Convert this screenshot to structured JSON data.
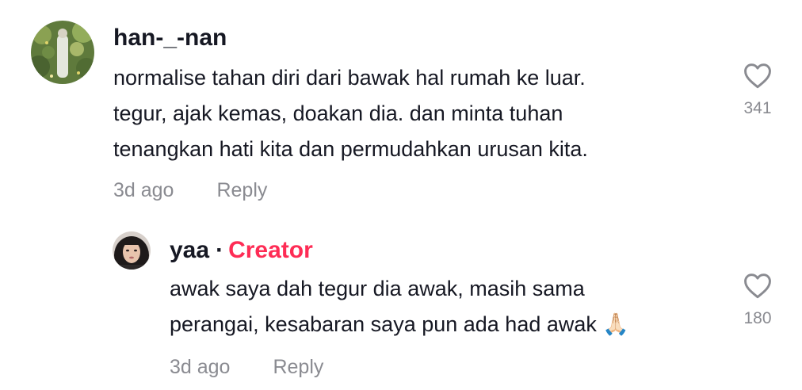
{
  "comments": [
    {
      "username": "han-_-nan",
      "lines": [
        "normalise tahan diri dari bawak hal rumah ke luar.",
        "tegur, ajak kemas, doakan dia. dan minta tuhan",
        "tenangkan hati kita dan permudahkan urusan kita."
      ],
      "time": "3d ago",
      "reply_label": "Reply",
      "like_count": "341",
      "like_icon": "heart-outline-icon"
    }
  ],
  "reply": {
    "username": "yaa",
    "separator": "·",
    "badge": "Creator",
    "badge_color": "#fe2c55",
    "lines": [
      "awak saya dah tegur dia awak, masih sama",
      "perangai, kesabaran saya pun ada had awak 🙏🏻"
    ],
    "time": "3d ago",
    "reply_label": "Reply",
    "like_count": "180",
    "like_icon": "heart-outline-icon"
  }
}
